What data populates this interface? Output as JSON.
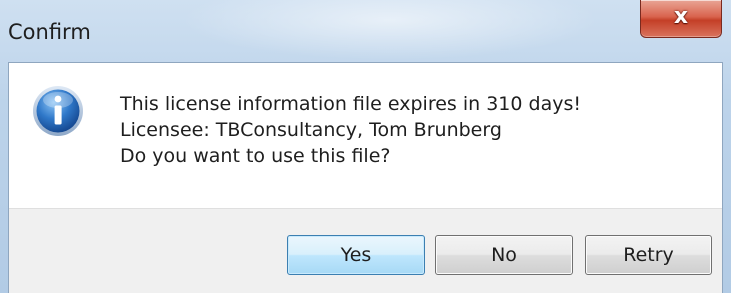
{
  "window": {
    "title": "Confirm",
    "close_icon": "close-icon",
    "close_glyph": "x"
  },
  "message": {
    "icon": "info-icon",
    "lines": [
      "This license information file expires in 310 days!",
      "Licensee: TBConsultancy, Tom Brunberg",
      "Do you want to use this file?"
    ]
  },
  "buttons": {
    "yes": "Yes",
    "no": "No",
    "retry": "Retry",
    "default": "yes"
  },
  "colors": {
    "titlebar": "#bcd3ea",
    "close_button": "#c43f27",
    "default_button_border": "#3c7fb1",
    "info_icon": "#1f5fb0"
  }
}
